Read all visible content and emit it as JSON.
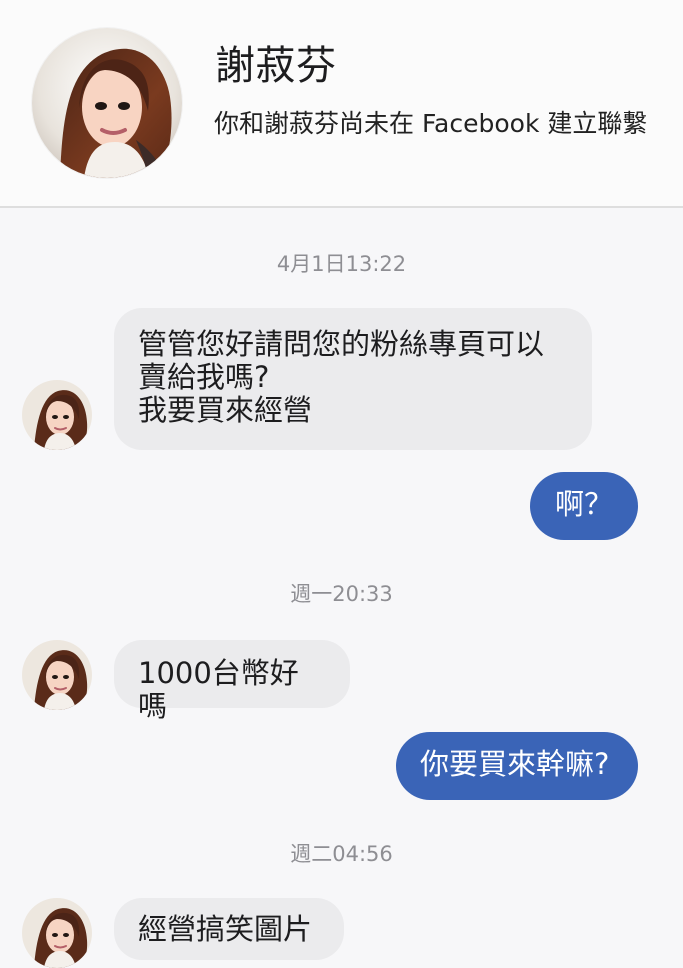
{
  "header": {
    "name": "謝菽芬",
    "subtitle": "你和謝菽芬尚未在 Facebook 建立聯繫",
    "avatar_icon": "profile-photo-icon"
  },
  "messages": [
    {
      "timestamp": "4月1日13:22"
    },
    {
      "incoming_1": "管管您好請問您的粉絲專頁可以\n賣給我嗎?\n我要買來經營",
      "outgoing_1": "啊？"
    },
    {
      "timestamp": "週一20:33"
    },
    {
      "incoming_2": "1000台幣好嗎",
      "outgoing_2": "你要買來幹嘛?"
    },
    {
      "timestamp": "週二04:56"
    },
    {
      "incoming_3": "經營搞笑圖片"
    }
  ],
  "colors": {
    "background": "#f7f7f9",
    "incoming_bubble": "#ebebed",
    "outgoing_bubble": "#3a64b7",
    "timestamp": "#8e8e93",
    "header_border": "#dedede"
  }
}
